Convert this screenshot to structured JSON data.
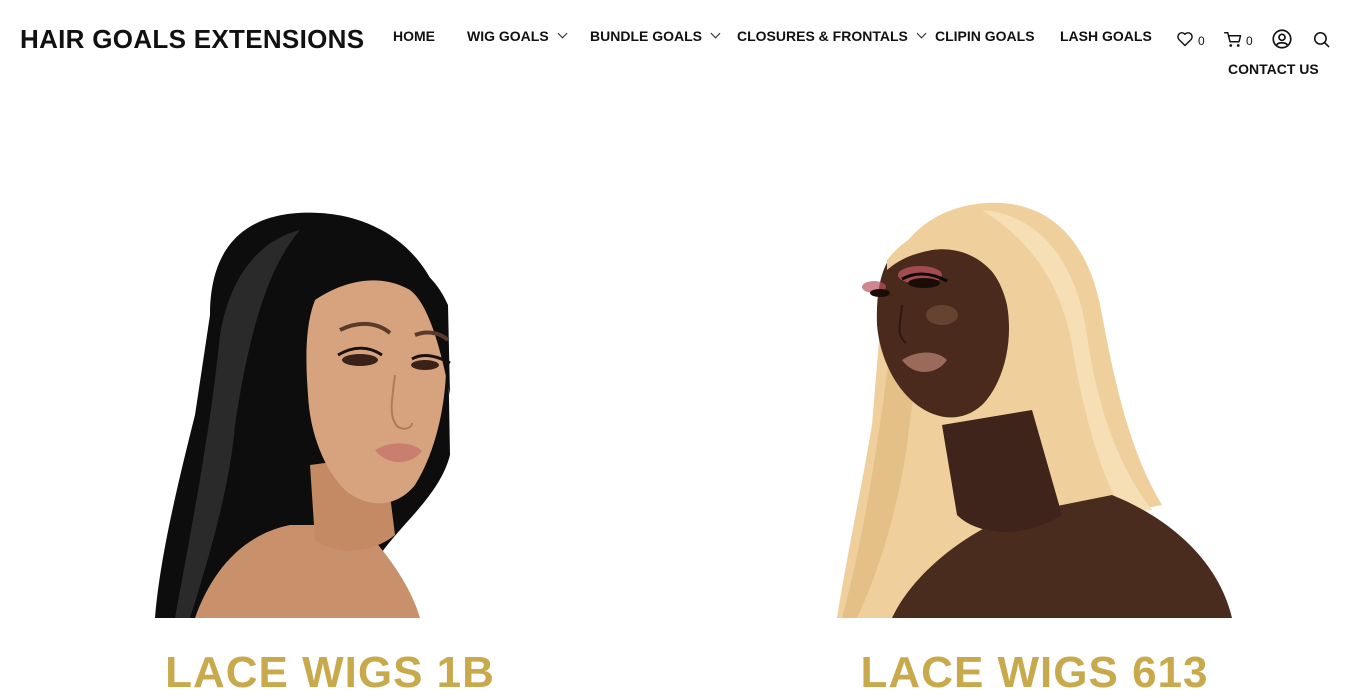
{
  "brand": {
    "name": "HAIR GOALS EXTENSIONS"
  },
  "nav": {
    "home": "HOME",
    "wig_goals": "WIG GOALS",
    "bundle_goals": "BUNDLE GOALS",
    "closures_frontals": "CLOSURES & FRONTALS",
    "clipin_goals": "CLIPIN GOALS",
    "lash_goals": "LASH GOALS",
    "contact_us": "CONTACT US"
  },
  "header_icons": {
    "wishlist": {
      "icon": "heart-icon",
      "count": "0"
    },
    "cart": {
      "icon": "cart-icon",
      "count": "0"
    },
    "account": {
      "icon": "user-icon"
    },
    "search": {
      "icon": "search-icon"
    }
  },
  "products": [
    {
      "title": "LACE WIGS 1B",
      "image": "model-black-straight-hair"
    },
    {
      "title": "LACE WIGS 613",
      "image": "model-blonde-straight-hair"
    }
  ],
  "colors": {
    "accent": "#c8a94c",
    "text": "#111111",
    "background": "#ffffff"
  }
}
